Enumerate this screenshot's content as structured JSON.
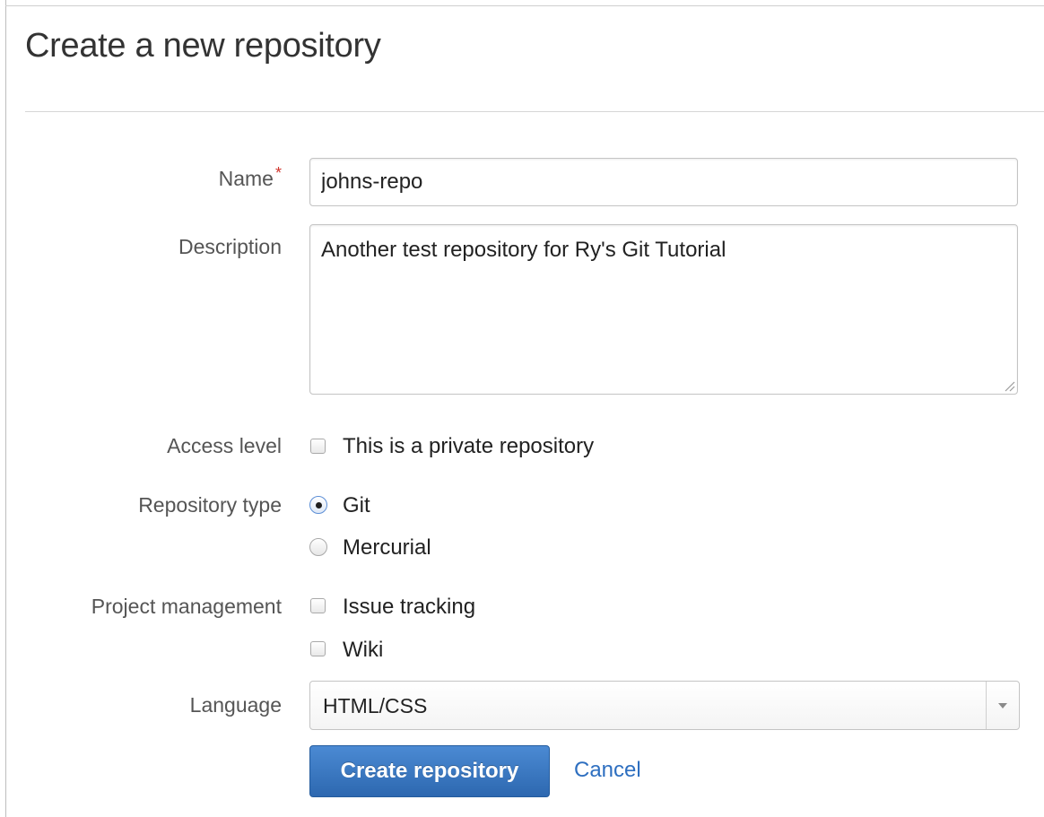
{
  "page": {
    "title": "Create a new repository"
  },
  "form": {
    "name": {
      "label": "Name",
      "required_marker": "*",
      "value": "johns-repo"
    },
    "description": {
      "label": "Description",
      "value": "Another test repository for Ry's Git Tutorial"
    },
    "access_level": {
      "label": "Access level",
      "option_label": "This is a private repository",
      "checked": false
    },
    "repository_type": {
      "label": "Repository type",
      "options": [
        {
          "label": "Git",
          "selected": true
        },
        {
          "label": "Mercurial",
          "selected": false
        }
      ]
    },
    "project_management": {
      "label": "Project management",
      "options": [
        {
          "label": "Issue tracking",
          "checked": false
        },
        {
          "label": "Wiki",
          "checked": false
        }
      ]
    },
    "language": {
      "label": "Language",
      "selected": "HTML/CSS"
    },
    "actions": {
      "submit_label": "Create repository",
      "cancel_label": "Cancel"
    }
  },
  "colors": {
    "primary_button": "#3a78c2",
    "link": "#2e6fc0",
    "required": "#d0342c"
  }
}
